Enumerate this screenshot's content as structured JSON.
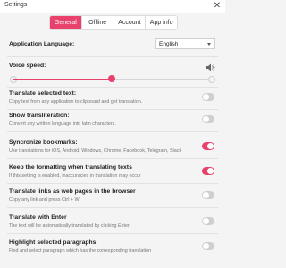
{
  "window": {
    "title": "Settings"
  },
  "tabs": [
    {
      "label": "General",
      "active": true
    },
    {
      "label": "Offline",
      "active": false
    },
    {
      "label": "Account",
      "active": false
    },
    {
      "label": "App info",
      "active": false
    }
  ],
  "language": {
    "label": "Application Language:",
    "selected": "English"
  },
  "voice": {
    "label": "Voice speed:",
    "level_fraction": 0.5
  },
  "settings": [
    {
      "label": "Translate selected text:",
      "desc": "Copy text from any application to clipboard and get translation.",
      "enabled": false
    },
    {
      "label": "Show transliteration:",
      "desc": "Convert any written language into latin characters.",
      "enabled": false
    },
    {
      "label": "Syncronize bookmarks:",
      "desc": "Use translations for iOS, Android, Windows, Chrome, Facebook, Telegram, Slack",
      "enabled": true
    },
    {
      "label": "Keep the formatting when translating texts",
      "desc": "If this setting is enabled, inaccuracies in translation may occur",
      "enabled": true
    },
    {
      "label": "Translate links as web pages in the browser",
      "desc": "Copy any link and press Ctrl + W",
      "enabled": false
    },
    {
      "label": "Translate with Enter",
      "desc": "The text will be automatically translated by clicking Enter",
      "enabled": false
    },
    {
      "label": "Highlight selected paragraphs",
      "desc": "Find and select paragraph which has the corresponding translation",
      "enabled": false
    }
  ],
  "colors": {
    "accent": "#e8416b",
    "toggle_off": "#cfcfcf"
  },
  "icons": {
    "close": "close-icon",
    "volume": "volume-icon",
    "dropdown": "chevron-down-icon"
  }
}
